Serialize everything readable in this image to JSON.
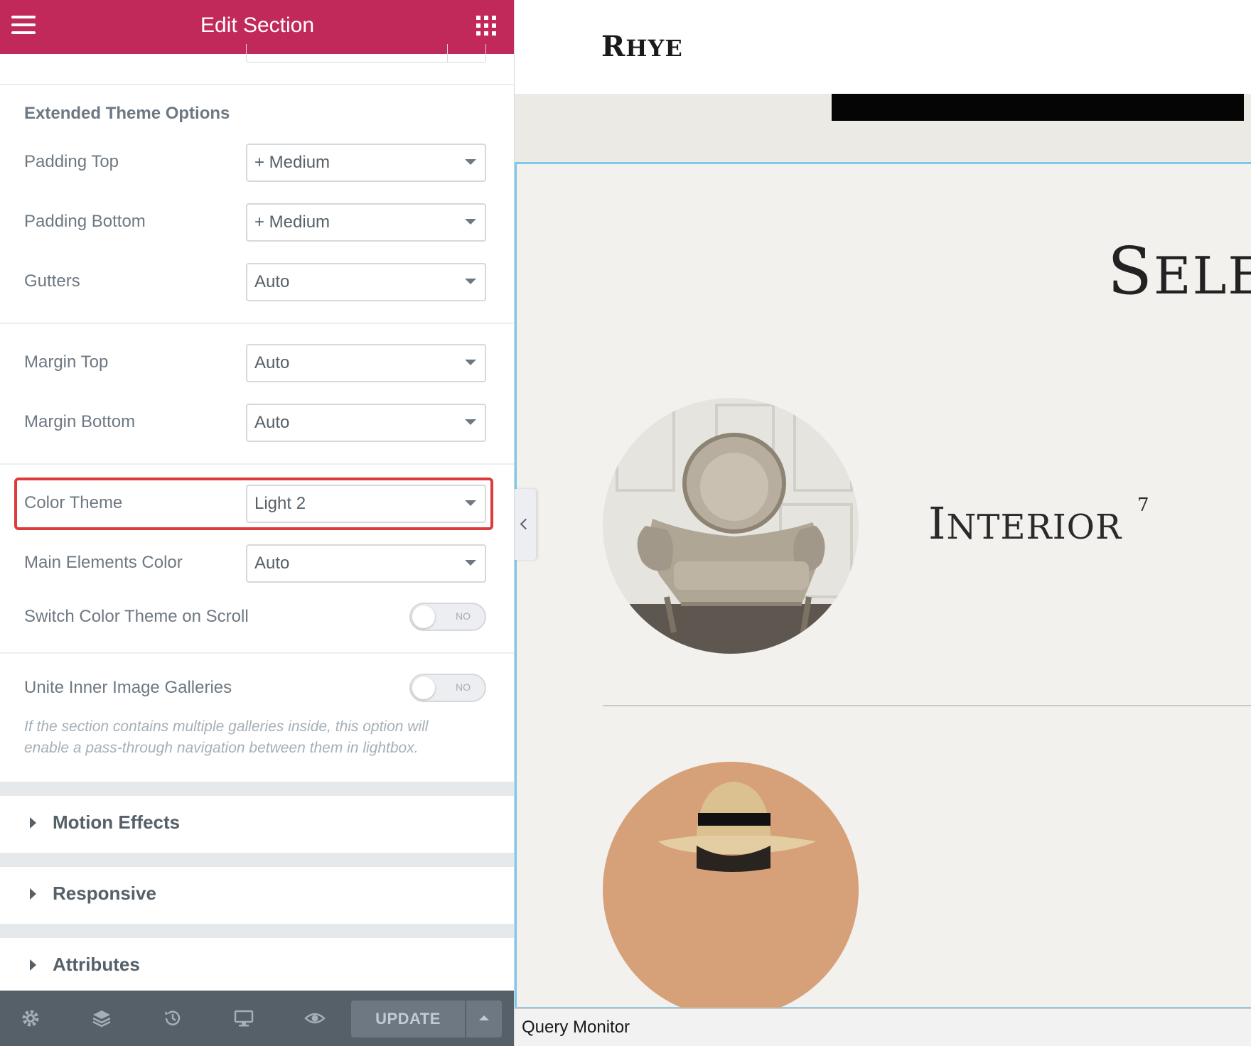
{
  "panel": {
    "title": "Edit Section",
    "group_title": "Extended Theme Options",
    "fields": {
      "padding_top": {
        "label": "Padding Top",
        "value": "+ Medium"
      },
      "padding_bottom": {
        "label": "Padding Bottom",
        "value": "+ Medium"
      },
      "gutters": {
        "label": "Gutters",
        "value": "Auto"
      },
      "margin_top": {
        "label": "Margin Top",
        "value": "Auto"
      },
      "margin_bottom": {
        "label": "Margin Bottom",
        "value": "Auto"
      },
      "color_theme": {
        "label": "Color Theme",
        "value": "Light 2"
      },
      "main_elements_color": {
        "label": "Main Elements Color",
        "value": "Auto"
      },
      "switch_color_theme": {
        "label": "Switch Color Theme on Scroll",
        "value": "NO"
      },
      "unite_galleries": {
        "label": "Unite Inner Image Galleries",
        "value": "NO"
      }
    },
    "help_text": "If the section contains multiple galleries inside, this option will enable a pass-through navigation between them in lightbox.",
    "sections": [
      "Motion Effects",
      "Responsive",
      "Attributes"
    ],
    "footer": {
      "update_label": "UPDATE"
    }
  },
  "preview": {
    "logo": {
      "first": "R",
      "rest": "HYE"
    },
    "heading": {
      "first": "S",
      "rest": "ELEC"
    },
    "interior": {
      "first": "I",
      "rest": "NTERIOR",
      "count": "7"
    },
    "query_monitor_label": "Query Monitor"
  },
  "colors": {
    "header_accent": "#c2295b",
    "highlight_border": "#dd3b3b",
    "section_outline": "#7ec8ea",
    "footer_bg": "#556068"
  },
  "icons": {
    "header_left": "hamburger-menu-icon",
    "header_right": "apps-grid-icon",
    "footer": [
      "settings-icon",
      "layers-icon",
      "history-icon",
      "responsive-desktop-icon",
      "preview-eye-icon"
    ]
  }
}
